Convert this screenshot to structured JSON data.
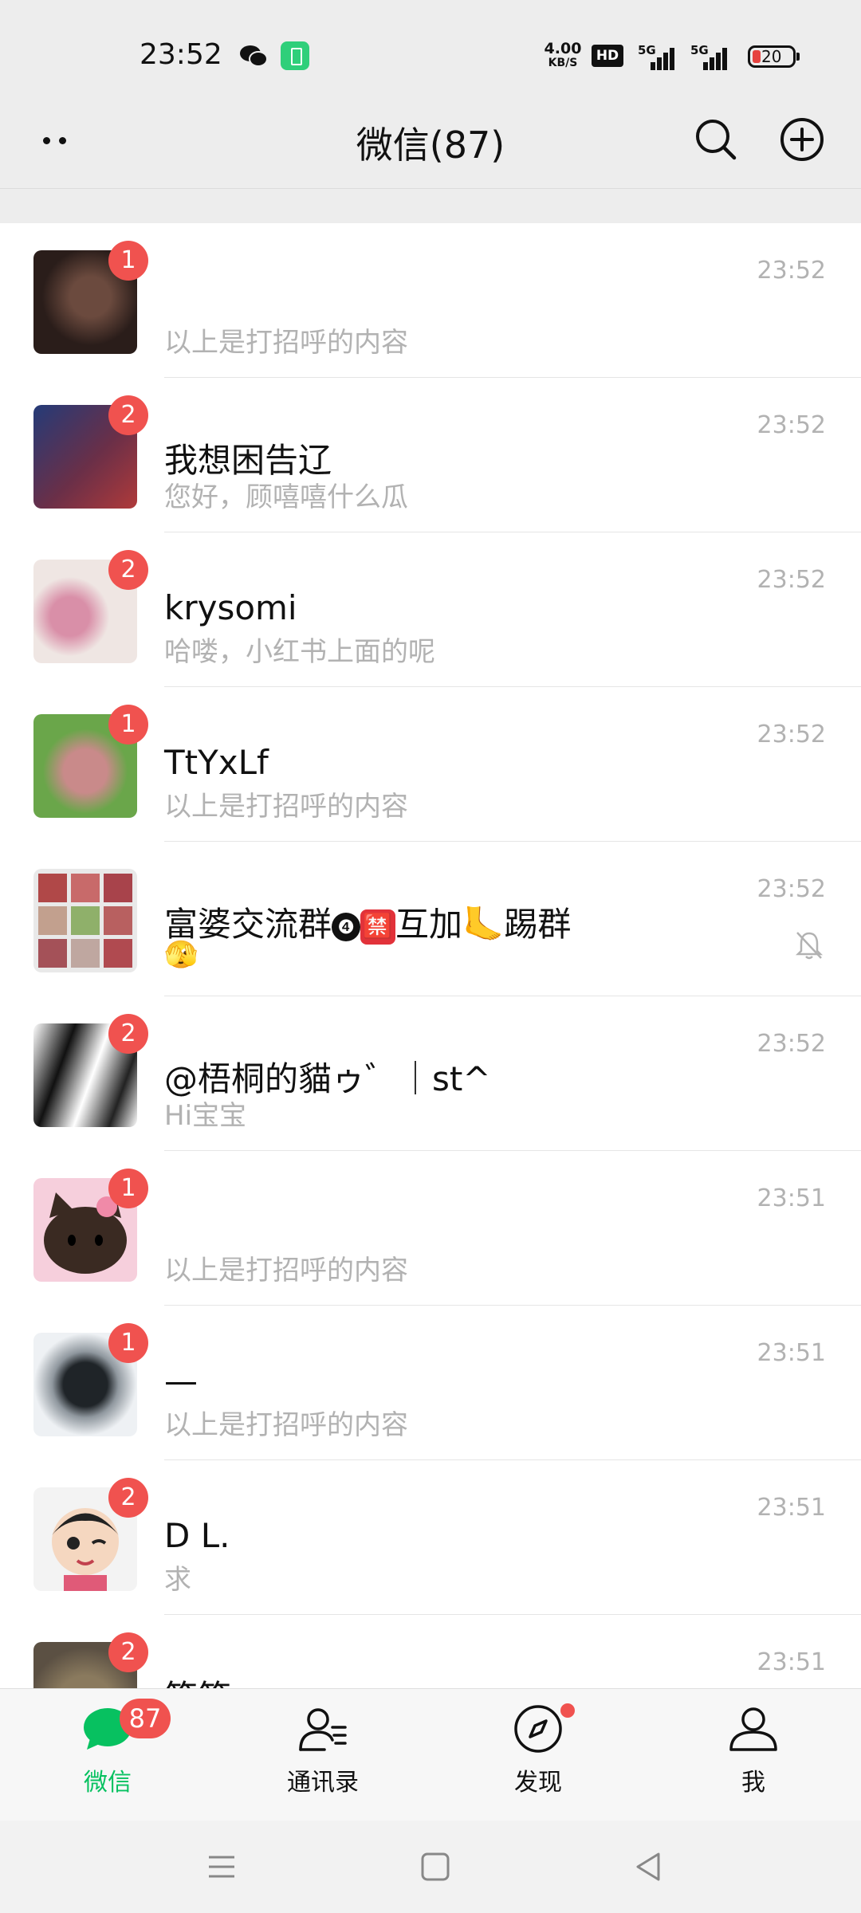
{
  "status_bar": {
    "time": "23:52",
    "net_speed_value": "4.00",
    "net_speed_unit": "KB/S",
    "hd_label": "HD",
    "signal1_label": "5G",
    "signal2_label": "5G",
    "battery_level": "20"
  },
  "header": {
    "title": "微信(87)"
  },
  "chats": [
    {
      "name": "",
      "message": "以上是打招呼的内容",
      "time": "23:52",
      "badge": "1",
      "avatar_colors": [
        "#2a1d1a",
        "#6b4a3e"
      ]
    },
    {
      "name": "我想困告辽",
      "message": "您好，顾嘻嘻什么瓜",
      "time": "23:52",
      "badge": "2",
      "avatar_colors": [
        "#243b78",
        "#b03a3a"
      ]
    },
    {
      "name": "krysomi",
      "message": "哈喽，小红书上面的呢",
      "time": "23:52",
      "badge": "2",
      "avatar_colors": [
        "#efe6e3",
        "#d98fa8"
      ]
    },
    {
      "name": "TtYxLf",
      "message": "以上是打招呼的内容",
      "time": "23:52",
      "badge": "1",
      "avatar_colors": [
        "#6aa64a",
        "#c98a8a"
      ]
    },
    {
      "name_parts": [
        "富婆交流群",
        "❹",
        "🈲",
        "互加",
        "🦶",
        "踢群"
      ],
      "message": "🫣",
      "time": "23:52",
      "badge": "",
      "muted": true,
      "avatar_colors": [
        "#e9e9e9",
        "#b04848"
      ]
    },
    {
      "name": "@梧桐的貓ゥ゛｜st^",
      "message": "Hi宝宝",
      "time": "23:52",
      "badge": "2",
      "avatar_colors": [
        "#ffffff",
        "#111111"
      ]
    },
    {
      "name": "",
      "message": "以上是打招呼的内容",
      "time": "23:51",
      "badge": "1",
      "avatar_colors": [
        "#f6cfdc",
        "#3a2a22"
      ]
    },
    {
      "name": "—",
      "message": "以上是打招呼的内容",
      "time": "23:51",
      "badge": "1",
      "avatar_colors": [
        "#eef1f4",
        "#1f2428"
      ]
    },
    {
      "name": "D L.",
      "message": "求",
      "time": "23:51",
      "badge": "2",
      "avatar_colors": [
        "#f3f3f3",
        "#e05a78"
      ]
    },
    {
      "name": "笨笨",
      "message": "",
      "time": "23:51",
      "badge": "2",
      "avatar_colors": [
        "#8a7a5e",
        "#5b5043"
      ]
    }
  ],
  "tabbar": {
    "tabs": [
      {
        "label": "微信",
        "badge": "87",
        "icon": "chat-bubble-icon"
      },
      {
        "label": "通讯录",
        "icon": "contacts-icon"
      },
      {
        "label": "发现",
        "icon": "compass-icon"
      },
      {
        "label": "我",
        "icon": "person-icon"
      }
    ],
    "active_color": "#07c160"
  }
}
